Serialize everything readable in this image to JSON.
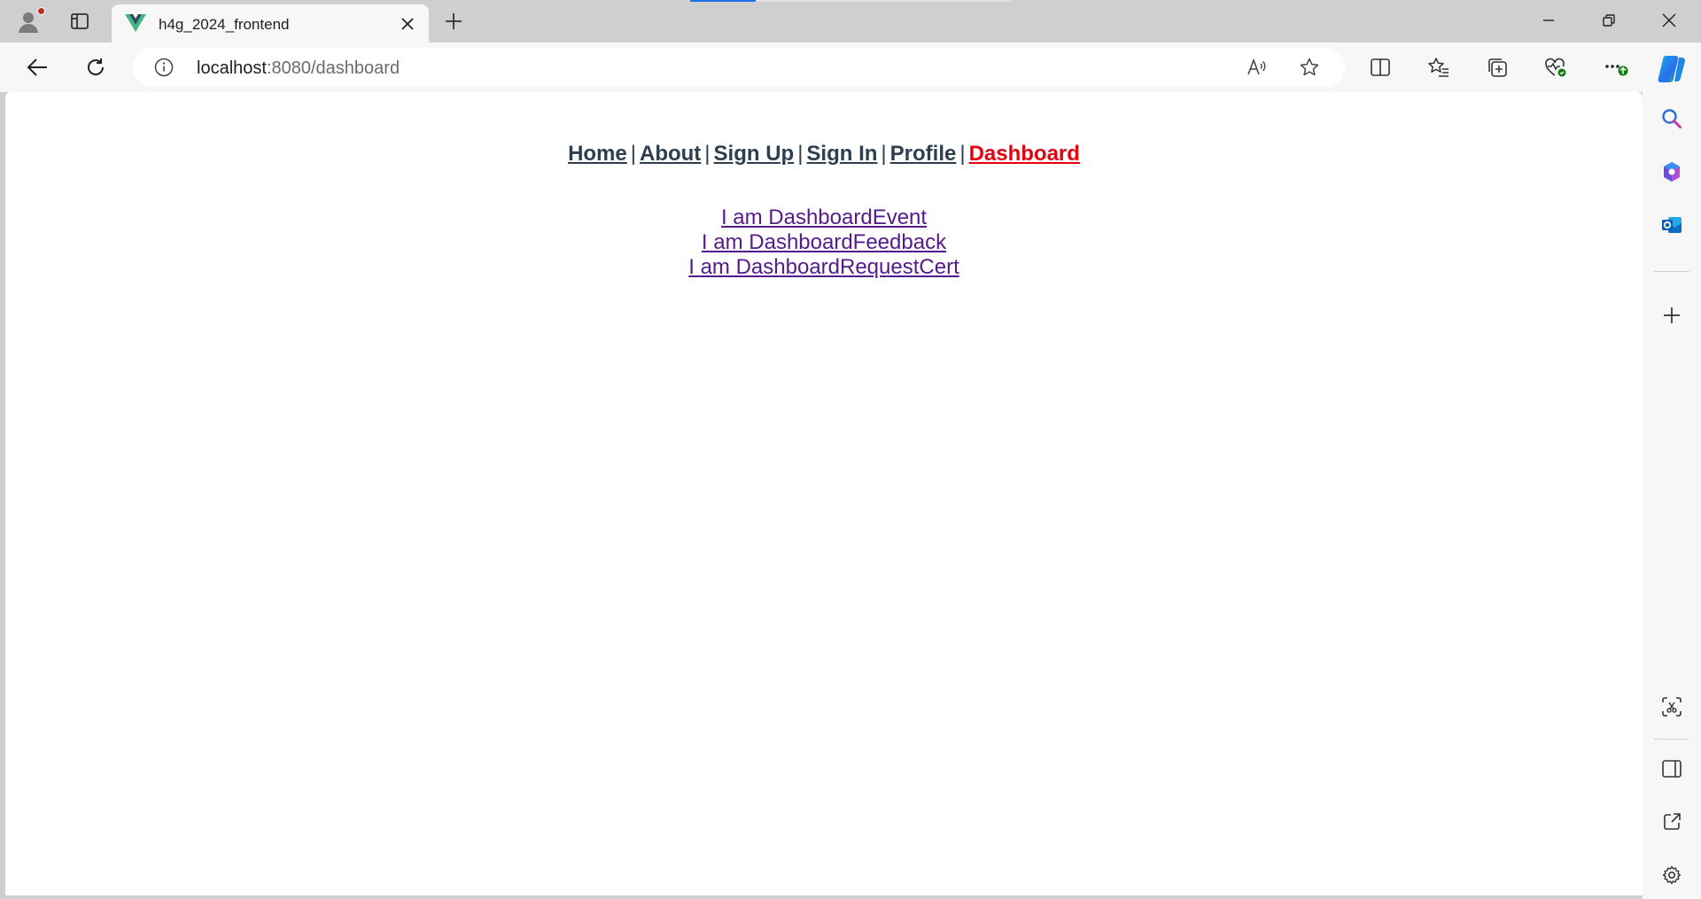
{
  "browser": {
    "tab": {
      "title": "h4g_2024_frontend",
      "favicon": "vue-logo-icon"
    },
    "address": {
      "host": "localhost",
      "path": ":8080/dashboard"
    },
    "icons": {
      "profile": "profile-icon",
      "tab_actions": "tab-actions-icon",
      "new_tab": "plus-icon",
      "back": "back-arrow-icon",
      "refresh": "refresh-icon",
      "site_info": "info-icon",
      "read_aloud": "read-aloud-icon",
      "favorite": "star-icon",
      "split_screen": "split-screen-icon",
      "favorites": "favorites-icon",
      "collections": "collections-icon",
      "browser_essentials": "heart-pulse-icon",
      "more": "more-icon",
      "copilot": "copilot-icon"
    },
    "sidebar_icons": [
      "search-icon",
      "copilot-m365-icon",
      "outlook-icon",
      "plus-icon",
      "screenshot-icon",
      "sidebar-toggle-icon",
      "open-external-icon",
      "settings-gear-icon"
    ]
  },
  "page": {
    "nav": {
      "items": [
        {
          "label": "Home"
        },
        {
          "label": "About"
        },
        {
          "label": "Sign Up"
        },
        {
          "label": "Sign In"
        },
        {
          "label": "Profile"
        },
        {
          "label": "Dashboard"
        }
      ],
      "separator": "|",
      "active": "Dashboard"
    },
    "dashboard_links": [
      {
        "label": "I am DashboardEvent"
      },
      {
        "label": "I am DashboardFeedback"
      },
      {
        "label": "I am DashboardRequestCert"
      }
    ]
  },
  "colors": {
    "nav_text": "#2c3e50",
    "nav_active": "#e3000f",
    "visited_link": "#551a8b",
    "loading_accent": "#1a73e8"
  }
}
